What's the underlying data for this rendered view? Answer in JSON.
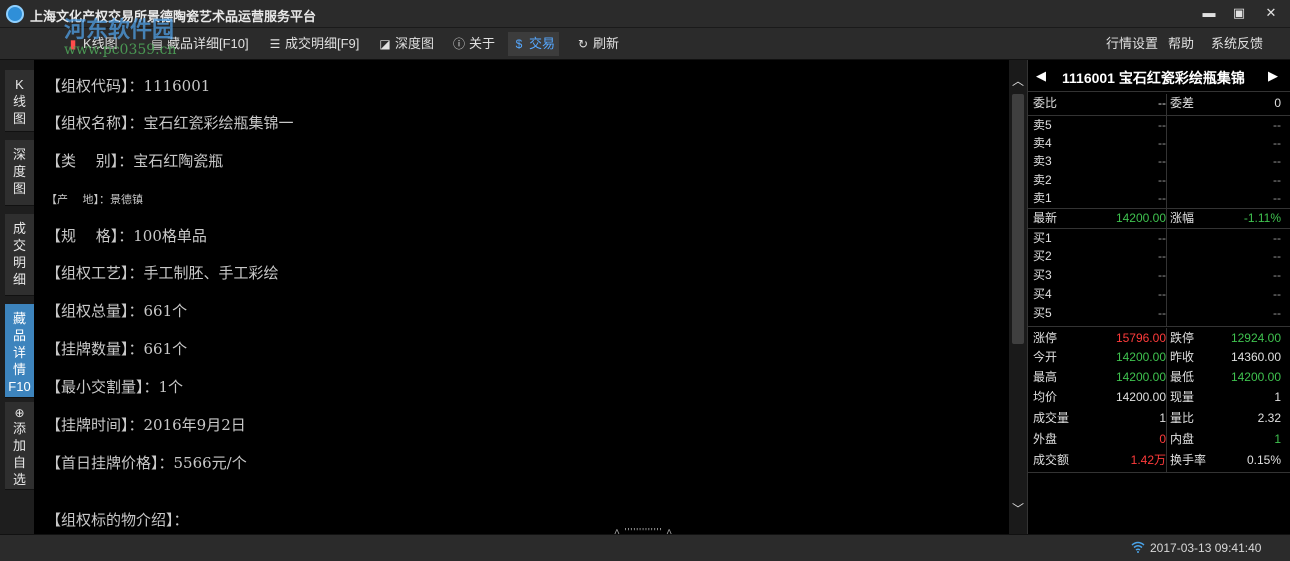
{
  "window": {
    "title": "上海文化产权交易所景德陶瓷艺术品运营服务平台",
    "minimize": "▬",
    "maximize": "▣",
    "close": "✕"
  },
  "watermark": {
    "text": "河东软件园",
    "url": "www.pc0359.cn"
  },
  "toolbar": {
    "items": [
      {
        "label": "K线图"
      },
      {
        "label": "藏品详细[F10]"
      },
      {
        "label": "成交明细[F9]"
      },
      {
        "label": "深度图"
      },
      {
        "label": "关于"
      },
      {
        "label": "交易"
      },
      {
        "label": "刷新"
      }
    ],
    "right": [
      {
        "label": "行情设置"
      },
      {
        "label": "帮助"
      },
      {
        "label": "系统反馈"
      }
    ]
  },
  "leftnav": {
    "kline": [
      "K",
      "线",
      "图"
    ],
    "depth": [
      "深",
      "度",
      "图"
    ],
    "trades": [
      "成",
      "交",
      "明",
      "细"
    ],
    "detail": [
      "藏",
      "品",
      "详",
      "情",
      "F10"
    ],
    "add": {
      "plus": "⊕",
      "text": [
        "添",
        "加",
        "自",
        "选"
      ]
    }
  },
  "detail": {
    "lines": [
      "【组权代码】：1116001",
      "【组权名称】：宝石红瓷彩绘瓶集锦一",
      "【类　 别】：宝石红陶瓷瓶",
      "【产　 地】：景德镇",
      "【规　 格】：100格单品",
      "【组权工艺】：手工制胚、手工彩绘",
      "【组权总量】：661个",
      "【挂牌数量】：661个",
      "【最小交割量】：1个",
      "【挂牌时间】：2016年9月2日",
      "【首日挂牌价格】：5566元/个",
      "【组权标的物介绍】："
    ],
    "scroll_marker": "˄ ''''''''''''' ˄"
  },
  "scrollbar": {
    "up": "︿",
    "down": "﹀"
  },
  "quote": {
    "prev": "◀",
    "next": "▶",
    "title": "1116001 宝石红瓷彩绘瓶集锦",
    "weibi": {
      "label": "委比",
      "value": "--",
      "label2": "委差",
      "value2": "0"
    },
    "sells": [
      {
        "label": "卖5",
        "price": "--",
        "qty": "--"
      },
      {
        "label": "卖4",
        "price": "--",
        "qty": "--"
      },
      {
        "label": "卖3",
        "price": "--",
        "qty": "--"
      },
      {
        "label": "卖2",
        "price": "--",
        "qty": "--"
      },
      {
        "label": "卖1",
        "price": "--",
        "qty": "--"
      }
    ],
    "latest": {
      "label": "最新",
      "value": "14200.00",
      "label2": "涨幅",
      "value2": "-1.11%"
    },
    "buys": [
      {
        "label": "买1",
        "price": "--",
        "qty": "--"
      },
      {
        "label": "买2",
        "price": "--",
        "qty": "--"
      },
      {
        "label": "买3",
        "price": "--",
        "qty": "--"
      },
      {
        "label": "买4",
        "price": "--",
        "qty": "--"
      },
      {
        "label": "买5",
        "price": "--",
        "qty": "--"
      }
    ],
    "stats": [
      {
        "l1": "涨停",
        "v1": "15796.00",
        "c1": "red",
        "l2": "跌停",
        "v2": "12924.00",
        "c2": "green"
      },
      {
        "l1": "今开",
        "v1": "14200.00",
        "c1": "green",
        "l2": "昨收",
        "v2": "14360.00",
        "c2": ""
      },
      {
        "l1": "最高",
        "v1": "14200.00",
        "c1": "green",
        "l2": "最低",
        "v2": "14200.00",
        "c2": "green"
      },
      {
        "l1": "均价",
        "v1": "14200.00",
        "c1": "",
        "l2": "现量",
        "v2": "1",
        "c2": ""
      },
      {
        "l1": "成交量",
        "v1": "1",
        "c1": "",
        "l2": "量比",
        "v2": "2.32",
        "c2": ""
      },
      {
        "l1": "外盘",
        "v1": "0",
        "c1": "red",
        "l2": "内盘",
        "v2": "1",
        "c2": "green"
      },
      {
        "l1": "成交额",
        "v1": "1.42万",
        "c1": "red",
        "l2": "换手率",
        "v2": "0.15%",
        "c2": ""
      }
    ]
  },
  "status": {
    "datetime": "2017-03-13 09:41:40"
  },
  "colors": {
    "up": "#ff3b3b",
    "down": "#3fc24f",
    "accent": "#3d84bd"
  }
}
